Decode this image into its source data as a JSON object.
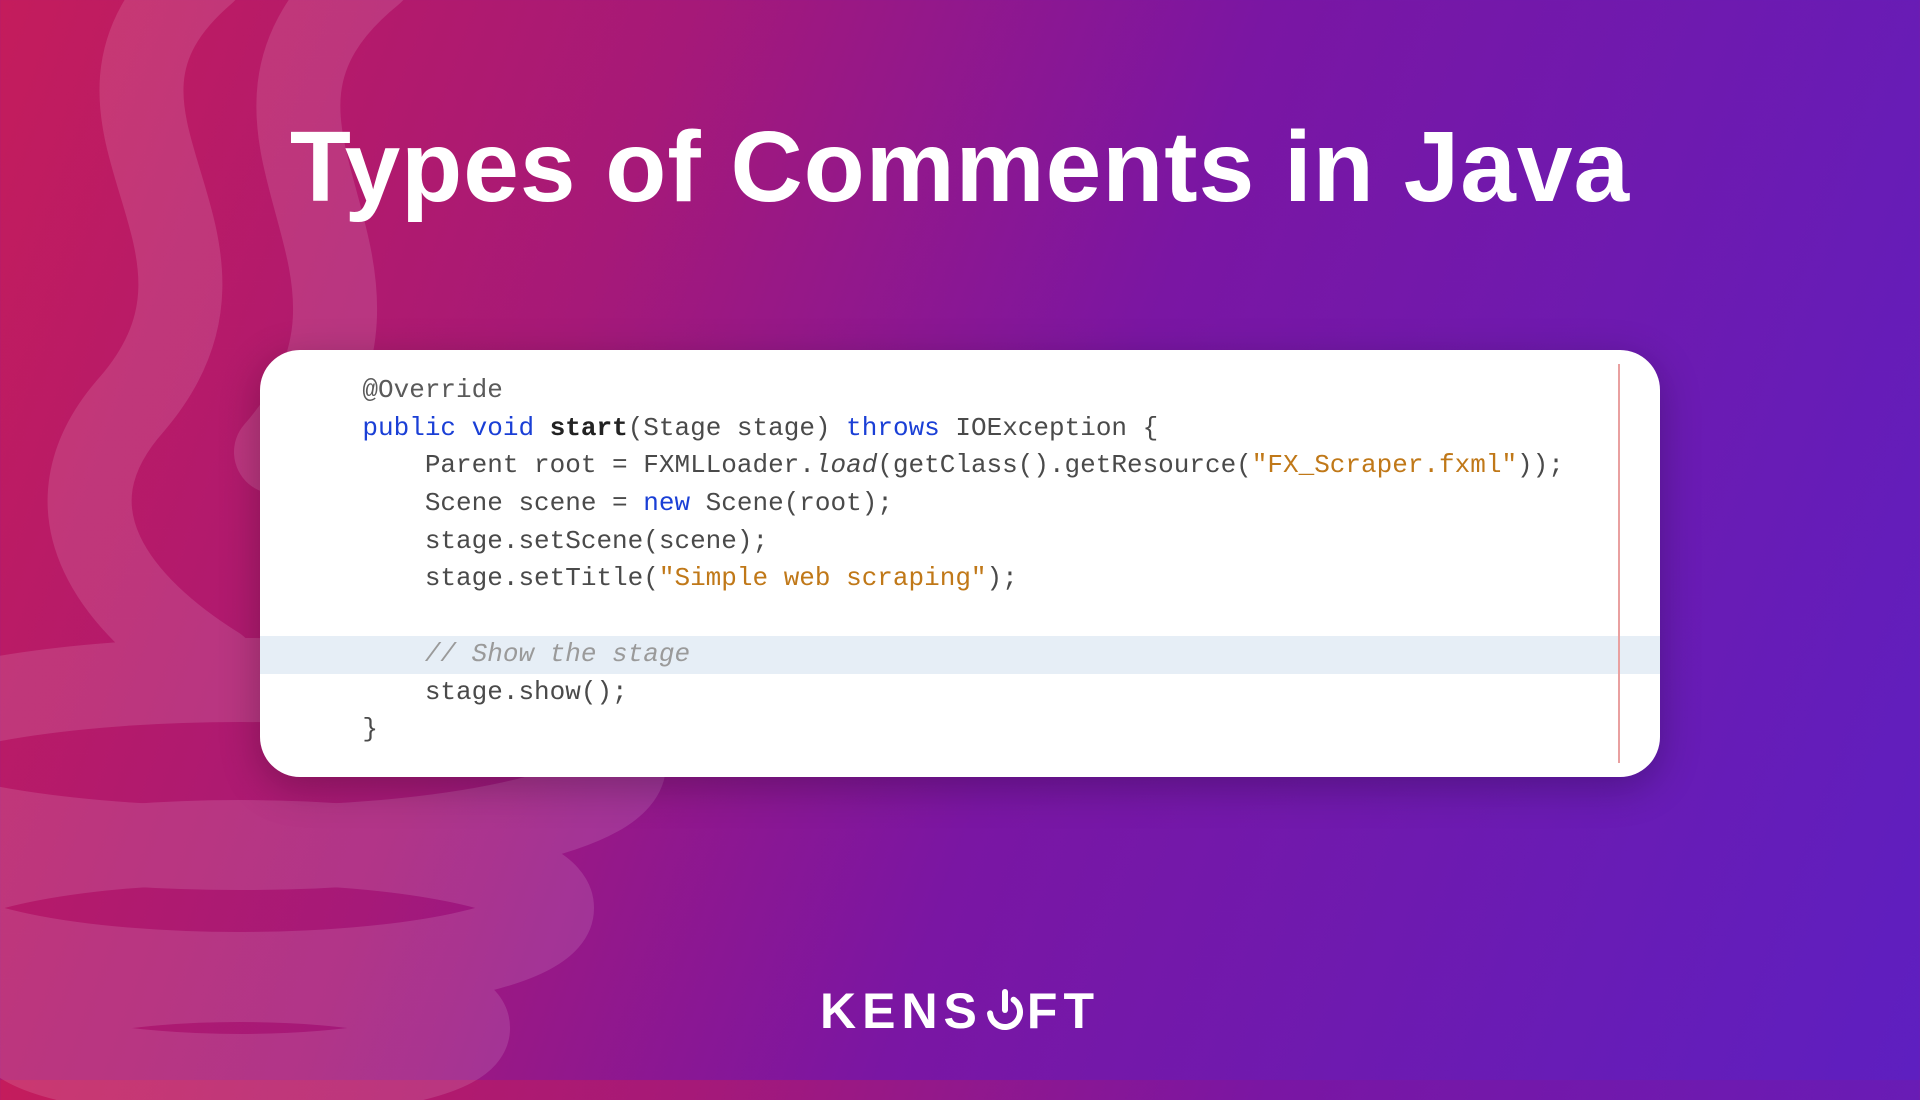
{
  "title": "Types of Comments in Java",
  "brand": {
    "left": "KENS",
    "right": "FT"
  },
  "code": {
    "ind1": "    ",
    "ind2": "        ",
    "annotation": "@Override",
    "kw_public": "public",
    "kw_void": "void",
    "fn_start": "start",
    "params": "(Stage stage)",
    "kw_throws": "throws",
    "exc": "IOException {",
    "l2a": "Parent root = FXMLLoader.",
    "l2i": "load",
    "l2b": "(getClass().getResource(",
    "l2s": "\"FX_Scraper.fxml\"",
    "l2c": "));",
    "l3a": "Scene scene = ",
    "kw_new": "new",
    "l3b": " Scene(root);",
    "l4": "stage.setScene(scene);",
    "l5a": "stage.setTitle(",
    "l5s": "\"Simple web scraping\"",
    "l5b": ");",
    "comment": "// Show the stage",
    "l7": "stage.show();",
    "close": "}"
  }
}
